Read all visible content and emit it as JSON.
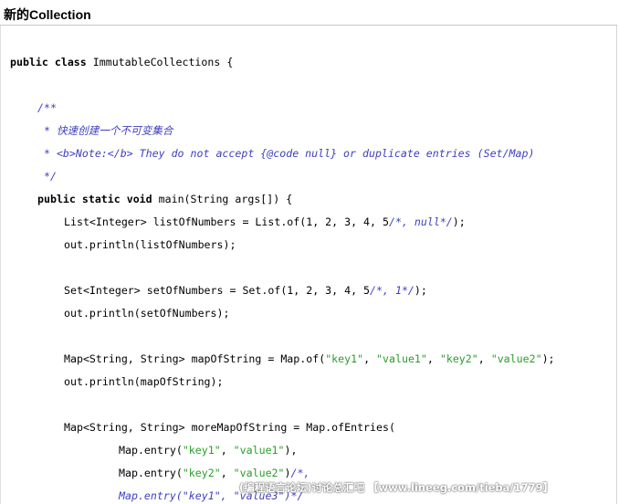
{
  "page_title": "新的Collection",
  "code": {
    "l1_kw": "public class ",
    "l1_rest": "ImmutableCollections {",
    "l2_doc_open": "/**",
    "l3_doc": " * 快速创建一个不可变集合",
    "l4_doc": " * <b>Note:</b> They do not accept {@code null} or duplicate entries (Set/Map)",
    "l5_doc_close": " */",
    "l6_kw": "public static void ",
    "l6_rest": "main(String args[]) {",
    "l7_code": "List<Integer> listOfNumbers = List.of(1, 2, 3, 4, 5",
    "l7_comment": "/*, null*/",
    "l7_end": ");",
    "l8_code": "out.println(listOfNumbers);",
    "l9_code": "Set<Integer> setOfNumbers = Set.of(1, 2, 3, 4, 5",
    "l9_comment": "/*, 1*/",
    "l9_end": ");",
    "l10_code": "out.println(setOfNumbers);",
    "l11_a": "Map<String, String> mapOfString = Map.of(",
    "l11_s1": "\"key1\"",
    "l11_s2": "\"value1\"",
    "l11_s3": "\"key2\"",
    "l11_s4": "\"value2\"",
    "l11_end": ");",
    "sep": ", ",
    "l12_code": "out.println(mapOfString);",
    "l13_code": "Map<String, String> moreMapOfString = Map.ofEntries(",
    "l14_a": "Map.entry(",
    "l14_s1": "\"key1\"",
    "l14_s2": "\"value1\"",
    "l14_end": "),",
    "l15_a": "Map.entry(",
    "l15_s1": "\"key2\"",
    "l15_s2": "\"value2\"",
    "l15_end": ")",
    "l15_comment": "/*,",
    "l16_comment": "Map.entry(\"key1\", \"value3\")*/"
  },
  "watermark": "(编程语言论坛)讨论总汇吧 【www.lineeg.com/tieba/1779】"
}
